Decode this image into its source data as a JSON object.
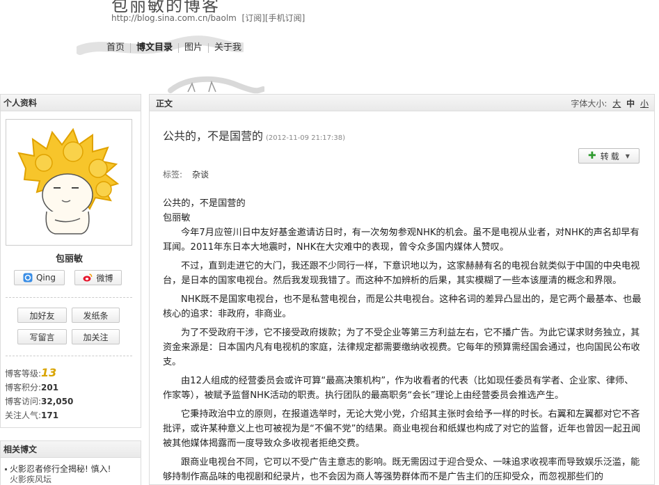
{
  "header": {
    "blog_title": "包丽敏的博客",
    "url": "http://blog.sina.com.cn/baolm",
    "subscribe_label": "[订阅]",
    "mobile_subscribe_label": "[手机订阅]"
  },
  "nav": {
    "items": [
      {
        "label": "首页"
      },
      {
        "label": "博文目录"
      },
      {
        "label": "图片"
      },
      {
        "label": "关于我"
      }
    ]
  },
  "profile": {
    "panel_title": "个人资料",
    "name": "包丽敏",
    "qing_label": "Qing",
    "weibo_label": "微博",
    "add_friend_label": "加好友",
    "send_note_label": "发纸条",
    "write_message_label": "写留言",
    "follow_label": "加关注",
    "stats": {
      "level_label": "博客等级:",
      "level_value": "13",
      "points_label": "博客积分:",
      "points_value": "201",
      "visits_label": "博客访问:",
      "visits_value": "32,050",
      "popularity_label": "关注人气:",
      "popularity_value": "171"
    }
  },
  "related": {
    "panel_title": "相关博文",
    "items": [
      {
        "label": "火影忍者修行全揭秘! 慎入!"
      },
      {
        "label": "火影疾风坛"
      }
    ]
  },
  "article": {
    "bar_label": "正文",
    "font_size_label": "字体大小:",
    "font_large": "大",
    "font_medium": "中",
    "font_small": "小",
    "title": "公共的，不是国营的",
    "time": "(2012-11-09 21:17:38)",
    "share_label": "转载",
    "tags_label": "标签:",
    "tag": "杂谈",
    "heading_line": "公共的，不是国营的",
    "author_line": "包丽敏",
    "paragraphs": [
      "今年7月应笹川日中友好基金邀请访日时，有一次匆匆参观NHK的机会。虽不是电视从业者，对NHK的声名却早有耳闻。2011年东日本大地震时，NHK在大灾难中的表现，曾令众多国内媒体人赞叹。",
      "不过，直到走进它的大门，我还跟不少同行一样，下意识地以为，这家赫赫有名的电视台就类似于中国的中央电视台，是日本的国家电视台。然后我发现我错了。而这种不加辨析的后果，其实模糊了一些本该厘清的概念和界限。",
      "NHK既不是国家电视台，也不是私营电视台，而是公共电视台。这种名词的差异凸显出的，是它两个最基本、也最核心的追求：非政府，非商业。",
      "为了不受政府干涉，它不接受政府拨款；为了不受企业等第三方利益左右，它不播广告。为此它谋求财务独立，其资金来源是：日本国内凡有电视机的家庭，法律规定都需要缴纳收视费。它每年的预算需经国会通过，也向国民公布收支。",
      "由12人组成的经营委员会或许可算“最高决策机构”，作为收看者的代表（比如现任委员有学者、企业家、律师、作家等），被赋予监督NHK活动的职责。执行团队的最高职务“会长”理论上由经营委员会推选产生。",
      "它秉持政治中立的原则，在报道选举时，无论大党小党，介绍其主张时会给予一样的时长。右翼和左翼都对它不吝批评，或许某种意义上也可被视为是“不偏不党”的结果。商业电视台和纸媒也构成了对它的监督，近年也曾因一起丑闻被其他媒体揭露而一度导致众多收视者拒绝交费。",
      "跟商业电视台不同，它可以不受广告主意志的影响。既无需因过于迎合受众、一味追求收视率而导致娱乐泛滥，能够持制作高品味的电视剧和纪录片，也不会因为商人等强势群体而不是广告主们的压抑受众，而忽视那些们的"
    ]
  }
}
